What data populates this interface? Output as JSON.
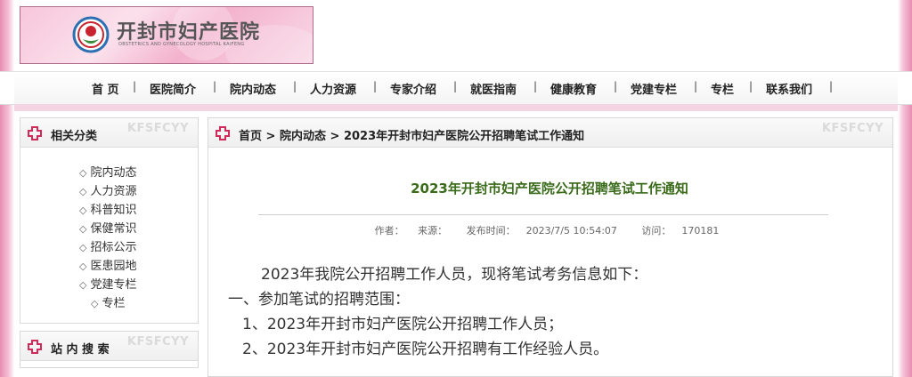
{
  "header": {
    "hospital_name": "开封市妇产医院",
    "hospital_name_en": "OBSTETRICS AND GYNECOLOGY HOSPITAL KAIFENG"
  },
  "nav": {
    "items": [
      "首 页",
      "医院简介",
      "院内动态",
      "人力资源",
      "专家介绍",
      "就医指南",
      "健康教育",
      "党建专栏",
      "专栏",
      "联系我们"
    ],
    "separator": "|"
  },
  "sidebar": {
    "title": "相关分类",
    "watermark": "KFSFCYY",
    "bullet": "◇",
    "items": [
      "院内动态",
      "人力资源",
      "科普知识",
      "保健常识",
      "招标公示",
      "医患园地",
      "党建专栏"
    ],
    "sub_item": "专栏"
  },
  "search_panel": {
    "title": "站 内 搜 索",
    "watermark": "KFSFCYY"
  },
  "breadcrumb": {
    "home": "首页",
    "sep1": " > ",
    "section": "院内动态",
    "sep2": " > ",
    "current": "2023年开封市妇产医院公开招聘笔试工作通知"
  },
  "article": {
    "watermark": "KFSFCYY",
    "title": "2023年开封市妇产医院公开招聘笔试工作通知",
    "author_label": "作者：",
    "source_label": "来源：",
    "published_label": "发布时间：",
    "published_value": "2023/7/5 10:54:07",
    "visits_label": "访问：",
    "visits_value": "170181",
    "paragraphs": [
      "2023年我院公开招聘工作人员，现将笔试考务信息如下：",
      "一、参加笔试的招聘范围：",
      "1、2023年开封市妇产医院公开招聘工作人员；",
      "2、2023年开封市妇产医院公开招聘有工作经验人员。"
    ]
  },
  "colors": {
    "side_pink": "#e98cb3",
    "title_green": "#3a6b1a",
    "icon_red": "#d0295a"
  }
}
